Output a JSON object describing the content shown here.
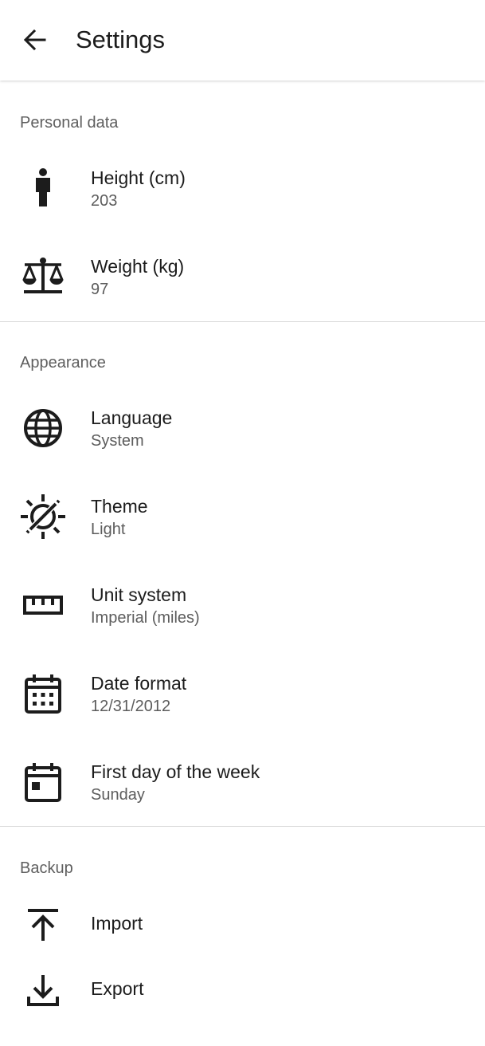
{
  "app_bar": {
    "title": "Settings",
    "back_icon": "arrow-back-icon"
  },
  "sections": [
    {
      "header": "Personal data",
      "items": [
        {
          "icon": "person-icon",
          "title": "Height (cm)",
          "value": "203"
        },
        {
          "icon": "scale-icon",
          "title": "Weight (kg)",
          "value": "97"
        }
      ]
    },
    {
      "header": "Appearance",
      "items": [
        {
          "icon": "globe-icon",
          "title": "Language",
          "value": "System"
        },
        {
          "icon": "theme-icon",
          "title": "Theme",
          "value": "Light"
        },
        {
          "icon": "ruler-icon",
          "title": "Unit system",
          "value": "Imperial (miles)"
        },
        {
          "icon": "calendar-grid-icon",
          "title": "Date format",
          "value": "12/31/2012"
        },
        {
          "icon": "calendar-day-icon",
          "title": "First day of the week",
          "value": "Sunday"
        }
      ]
    },
    {
      "header": "Backup",
      "items": [
        {
          "icon": "upload-icon",
          "title": "Import"
        },
        {
          "icon": "download-icon",
          "title": "Export"
        }
      ]
    }
  ],
  "colors": {
    "text_primary": "#1c1c1c",
    "text_secondary": "#5c5c5c",
    "divider": "#d9d9d9",
    "background": "#ffffff"
  }
}
